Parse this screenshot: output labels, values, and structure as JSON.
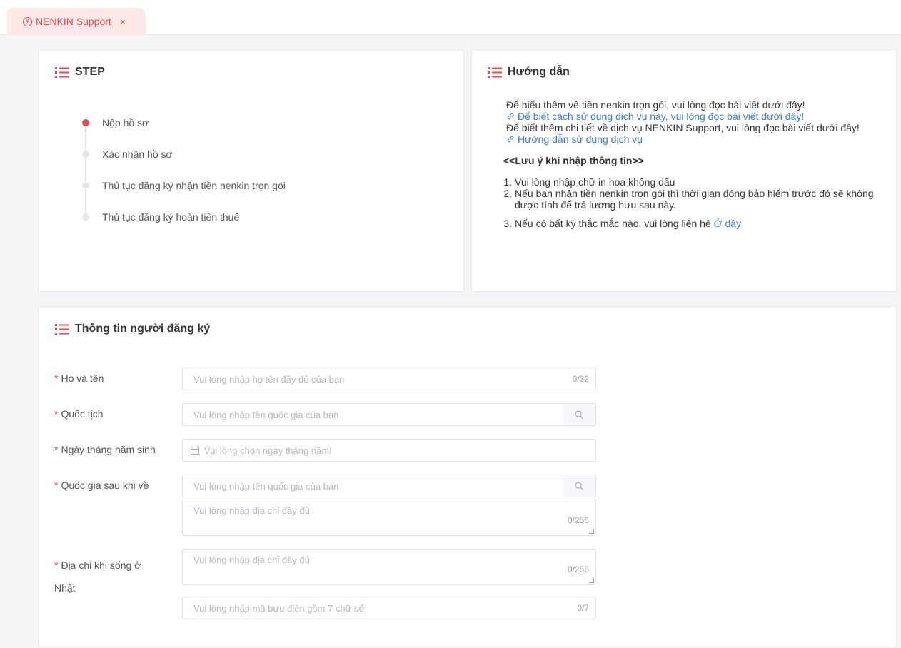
{
  "tab": {
    "label": "NENKIN Support",
    "icon": "yen-icon",
    "close": "×"
  },
  "colors": {
    "accent": "#e5484d",
    "link": "#3a7bd5",
    "inactive": "#e3e5ea"
  },
  "step_card": {
    "title": "STEP",
    "steps": [
      {
        "label": "Nộp hồ sơ",
        "active": true
      },
      {
        "label": "Xác nhận hồ sơ",
        "active": false
      },
      {
        "label": "Thủ tục đăng ký nhận tiền nenkin trọn gói",
        "active": false
      },
      {
        "label": "Thủ tục đăng ký hoàn tiền thuế",
        "active": false
      }
    ]
  },
  "guide_card": {
    "title": "Hướng dẫn",
    "line1": "Để hiểu thêm về tiền nenkin trọn gói, vui lòng đọc bài viết dưới đây!",
    "link1": "Để biết cách sử dụng dịch vụ này, vui lòng đọc bài viết dưới đây!",
    "line2": "Để biết thêm chi tiết về dịch vụ NENKIN Support, vui lòng đọc bài viết dưới đây!",
    "link2": "Hướng dẫn sử dụng dịch vụ",
    "note_title": "<<Lưu ý khi nhập thông tin>>",
    "notes": [
      "Vui lòng nhập chữ in hoa không dấu",
      "Nếu bạn nhận tiền nenkin trọn gói thì thời gian đóng bảo hiểm trước đó sẽ không được tính để trả lương hưu sau này."
    ],
    "note3_text": "Nếu có bất kỳ thắc mắc nào, vui lòng liên hệ ",
    "note3_link": "Ở đây"
  },
  "form": {
    "title": "Thông tin người đăng ký",
    "required_mark": "*",
    "fullname": {
      "label": "Họ và tên",
      "placeholder": "Vui lòng nhập họ tên đầy đủ của bạn",
      "counter": "0/32"
    },
    "nationality": {
      "label": "Quốc tịch",
      "placeholder": "Vui lòng nhập tên quốc gia của bạn"
    },
    "birthday": {
      "label": "Ngày tháng năm sinh",
      "placeholder": "Vui lòng chọn ngày tháng năm!"
    },
    "return_country": {
      "label": "Quốc gia sau khi về",
      "placeholder": "Vui lòng nhập tên quốc gia của bạn",
      "address_placeholder": "Vui lòng nhập địa chỉ đầy đủ",
      "address_counter": "0/256"
    },
    "japan_address": {
      "label_line1": "Địa chỉ khi sống ở",
      "label_line2": "Nhật",
      "placeholder": "Vui lòng nhập địa chỉ đầy đủ",
      "counter": "0/256",
      "postal_placeholder": "Vui lòng nhập mã bưu điện gồm 7 chữ số",
      "postal_counter": "0/7"
    }
  }
}
